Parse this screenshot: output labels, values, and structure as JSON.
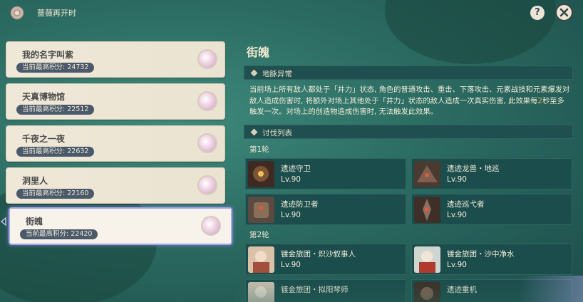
{
  "header": {
    "event_title": "蔷薇再开时",
    "help_symbol": "?",
    "icons": {
      "logo": "flower-gear-icon",
      "help": "question-icon",
      "close": "close-icon"
    }
  },
  "stages": [
    {
      "name": "我的名字叫紫",
      "score_label": "当前最高积分:",
      "score": "24732",
      "selected": false
    },
    {
      "name": "天真博物馆",
      "score_label": "当前最高积分:",
      "score": "22512",
      "selected": false
    },
    {
      "name": "千夜之一夜",
      "score_label": "当前最高积分:",
      "score": "22632",
      "selected": false
    },
    {
      "name": "洞里人",
      "score_label": "当前最高积分:",
      "score": "22160",
      "selected": false
    },
    {
      "name": "街魄",
      "score_label": "当前最高积分:",
      "score": "22420",
      "selected": true
    }
  ],
  "detail": {
    "title": "街魄",
    "ley_section_label": "地脉异常",
    "description_parts": [
      "当前场上所有敌人都处于「井力」状态, 角色的普通攻击、重击、下落攻击、元素战技和元素爆发对敌人造成伤害时, 将额外对场上其他处于「井力」状态的敌人造成一次真实伤害, 此效果每",
      "2",
      "秒至多触发一次。对场上的创造物造成伤害时, 无法触发此效果。"
    ],
    "enemy_section_label": "讨伐列表",
    "rounds": [
      {
        "label": "第1轮",
        "enemies": [
          {
            "name": "遗迹守卫",
            "level": "Lv.90"
          },
          {
            "name": "遗迹龙兽・地巡",
            "level": "Lv.90"
          },
          {
            "name": "遗迹防卫者",
            "level": "Lv.90"
          },
          {
            "name": "遗迹巡弋者",
            "level": "Lv.90"
          }
        ]
      },
      {
        "label": "第2轮",
        "enemies": [
          {
            "name": "镀金旅团・炽沙叙事人",
            "level": "Lv.90"
          },
          {
            "name": "镀金旅团・沙中净水",
            "level": "Lv.90"
          },
          {
            "name": "镀金旅团・拟阳琴师",
            "level": ""
          },
          {
            "name": "遗迹重机",
            "level": ""
          }
        ]
      }
    ]
  },
  "colors": {
    "accent_gold": "#e4b24a",
    "panel_teal": "#1b4d4c",
    "selected_border": "#a8a3e6",
    "pill": "#4b5a6a"
  }
}
